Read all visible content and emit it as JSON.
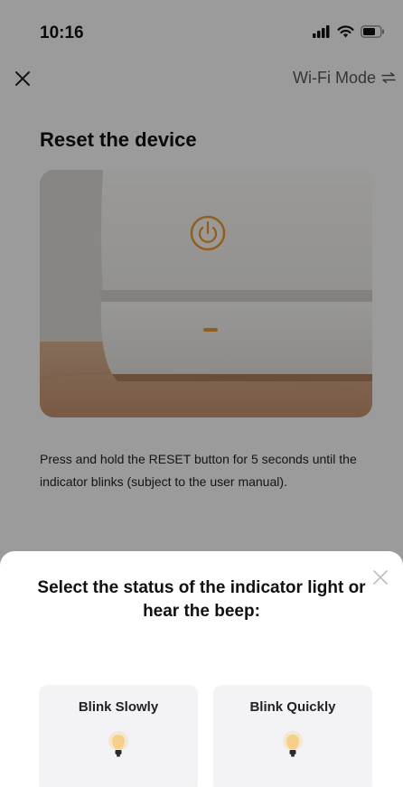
{
  "status_bar": {
    "time": "10:16",
    "icons": [
      "signal-icon",
      "wifi-icon",
      "battery-icon"
    ]
  },
  "nav": {
    "close_icon": "close-icon",
    "mode_label": "Wi-Fi Mode",
    "mode_icon": "switch-arrows-icon"
  },
  "page": {
    "title": "Reset the device",
    "instructions": "Press and hold the RESET button for 5 seconds until the indicator blinks (subject to the user manual)."
  },
  "sheet": {
    "title": "Select the status of the indicator light or hear the beep:",
    "options": [
      {
        "label": "Blink Slowly",
        "icon": "bulb-icon"
      },
      {
        "label": "Blink Quickly",
        "icon": "bulb-icon"
      }
    ]
  },
  "colors": {
    "overlay": "#000000",
    "sheet_bg": "#ffffff",
    "option_bg": "#f3f3f5",
    "indicator_orange": "#e8962e",
    "bulb_yellow": "#f6d08a"
  }
}
